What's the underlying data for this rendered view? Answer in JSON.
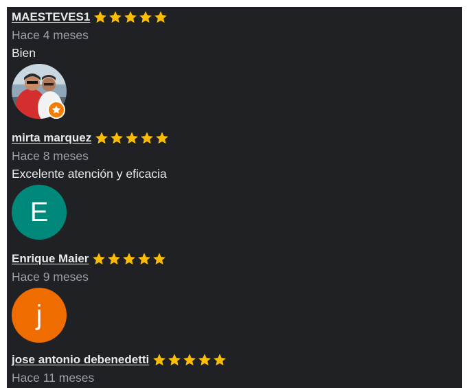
{
  "colors": {
    "panel_bg": "#202124",
    "star": "#fbbc04",
    "name_text": "#e8eaed",
    "date_text": "#9aa0a6",
    "avatar_e": "#00897b",
    "avatar_j": "#ef6c00",
    "local_guide_badge": "#f57c00"
  },
  "reviews": [
    {
      "name": "MAESTEVES1",
      "rating": 5,
      "date": "Hace 4 meses",
      "text": "Bien",
      "avatar": {
        "type": "photo",
        "badge": "local-guide-icon"
      }
    },
    {
      "name": "mirta marquez",
      "rating": 5,
      "date": "Hace 8 meses",
      "text": "Excelente atención y eficacia",
      "avatar": {
        "type": "letter",
        "letter": "E"
      }
    },
    {
      "name": "Enrique Maier",
      "rating": 5,
      "date": "Hace 9 meses",
      "avatar": {
        "type": "letter",
        "letter": "j"
      }
    },
    {
      "name": "jose antonio debenedetti",
      "rating": 5,
      "date": "Hace 11 meses"
    }
  ]
}
